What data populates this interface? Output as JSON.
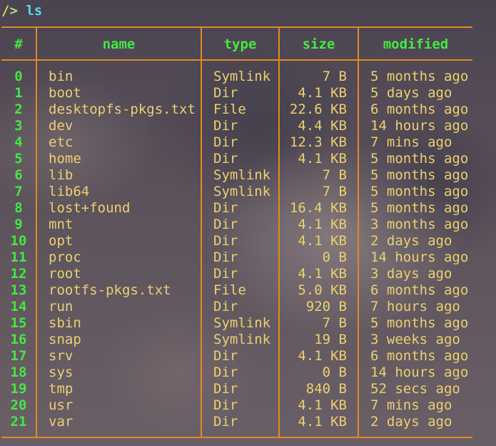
{
  "prompt": {
    "path": "/",
    "symbol": "> ",
    "command": "ls"
  },
  "columns": [
    "#",
    "name",
    "type",
    "size",
    "modified"
  ],
  "rows": [
    {
      "index": "0",
      "name": "bin",
      "type": "Symlink",
      "size": "7 B",
      "modified": "5 months ago"
    },
    {
      "index": "1",
      "name": "boot",
      "type": "Dir",
      "size": "4.1 KB",
      "modified": "5 days ago"
    },
    {
      "index": "2",
      "name": "desktopfs-pkgs.txt",
      "type": "File",
      "size": "22.6 KB",
      "modified": "6 months ago"
    },
    {
      "index": "3",
      "name": "dev",
      "type": "Dir",
      "size": "4.4 KB",
      "modified": "14 hours ago"
    },
    {
      "index": "4",
      "name": "etc",
      "type": "Dir",
      "size": "12.3 KB",
      "modified": "7 mins ago"
    },
    {
      "index": "5",
      "name": "home",
      "type": "Dir",
      "size": "4.1 KB",
      "modified": "5 months ago"
    },
    {
      "index": "6",
      "name": "lib",
      "type": "Symlink",
      "size": "7 B",
      "modified": "5 months ago"
    },
    {
      "index": "7",
      "name": "lib64",
      "type": "Symlink",
      "size": "7 B",
      "modified": "5 months ago"
    },
    {
      "index": "8",
      "name": "lost+found",
      "type": "Dir",
      "size": "16.4 KB",
      "modified": "5 months ago"
    },
    {
      "index": "9",
      "name": "mnt",
      "type": "Dir",
      "size": "4.1 KB",
      "modified": "3 months ago"
    },
    {
      "index": "10",
      "name": "opt",
      "type": "Dir",
      "size": "4.1 KB",
      "modified": "2 days ago"
    },
    {
      "index": "11",
      "name": "proc",
      "type": "Dir",
      "size": "0 B",
      "modified": "14 hours ago"
    },
    {
      "index": "12",
      "name": "root",
      "type": "Dir",
      "size": "4.1 KB",
      "modified": "3 days ago"
    },
    {
      "index": "13",
      "name": "rootfs-pkgs.txt",
      "type": "File",
      "size": "5.0 KB",
      "modified": "6 months ago"
    },
    {
      "index": "14",
      "name": "run",
      "type": "Dir",
      "size": "920 B",
      "modified": "7 hours ago"
    },
    {
      "index": "15",
      "name": "sbin",
      "type": "Symlink",
      "size": "7 B",
      "modified": "5 months ago"
    },
    {
      "index": "16",
      "name": "snap",
      "type": "Symlink",
      "size": "19 B",
      "modified": "3 weeks ago"
    },
    {
      "index": "17",
      "name": "srv",
      "type": "Dir",
      "size": "4.1 KB",
      "modified": "6 months ago"
    },
    {
      "index": "18",
      "name": "sys",
      "type": "Dir",
      "size": "0 B",
      "modified": "14 hours ago"
    },
    {
      "index": "19",
      "name": "tmp",
      "type": "Dir",
      "size": "840 B",
      "modified": "52 secs ago"
    },
    {
      "index": "20",
      "name": "usr",
      "type": "Dir",
      "size": "4.1 KB",
      "modified": "7 mins ago"
    },
    {
      "index": "21",
      "name": "var",
      "type": "Dir",
      "size": "4.1 KB",
      "modified": "2 days ago"
    }
  ],
  "colors": {
    "border": "#e08a22",
    "index_and_header": "#44e844",
    "cell_text": "#ecd070",
    "prompt_path": "#d8d84a",
    "prompt_command": "#58d8e8"
  }
}
